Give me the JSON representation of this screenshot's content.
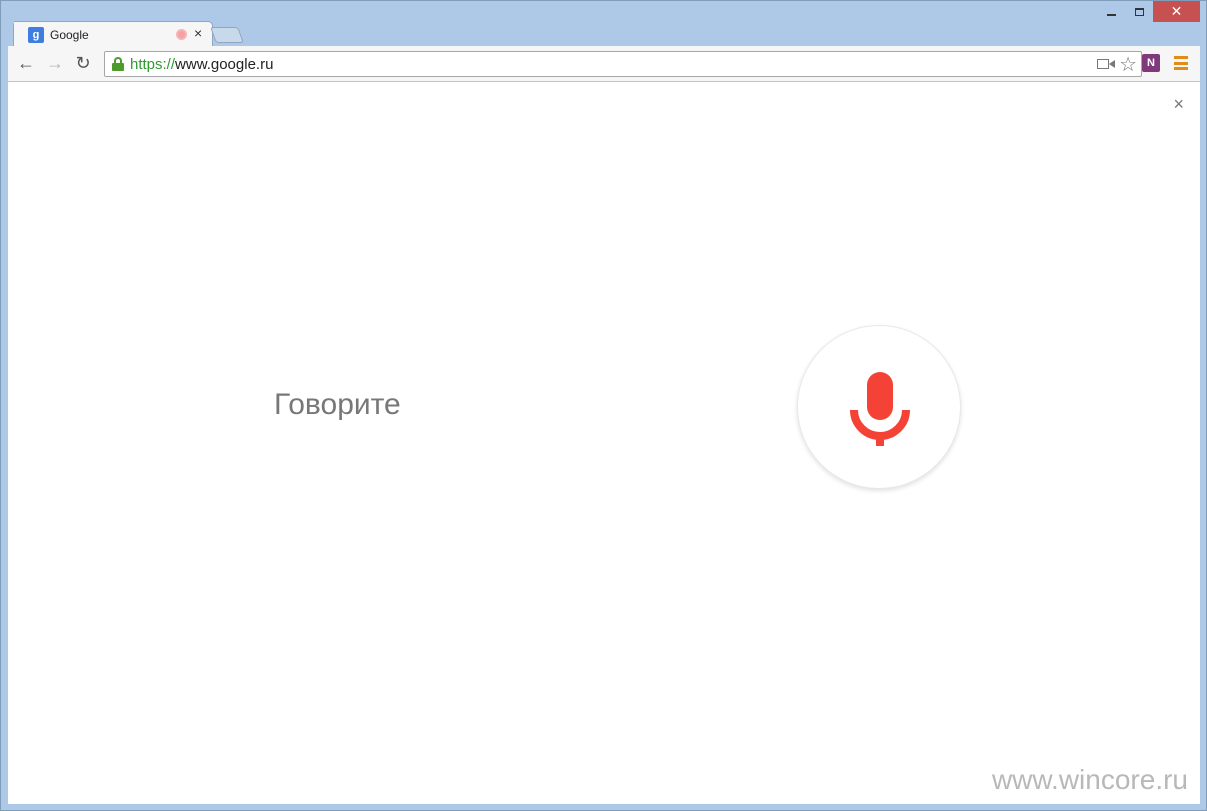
{
  "window": {
    "close_glyph": "✕",
    "minimize_label": "",
    "maximize_label": ""
  },
  "tab": {
    "favicon_letter": "g",
    "title": "Google",
    "close_glyph": "×"
  },
  "toolbar": {
    "back_glyph": "←",
    "forward_glyph": "→",
    "reload_glyph": "↻",
    "url_scheme": "https://",
    "url_rest": "www.google.ru",
    "star_glyph": "☆",
    "extension_label": "N"
  },
  "voice_search": {
    "close_glyph": "×",
    "prompt": "Говорите",
    "mic_color": "#f44336"
  },
  "watermark": "www.wincore.ru",
  "icons": [
    "lock-icon",
    "camera-icon",
    "star-icon",
    "onenote-icon",
    "menu-icon",
    "microphone-icon"
  ]
}
